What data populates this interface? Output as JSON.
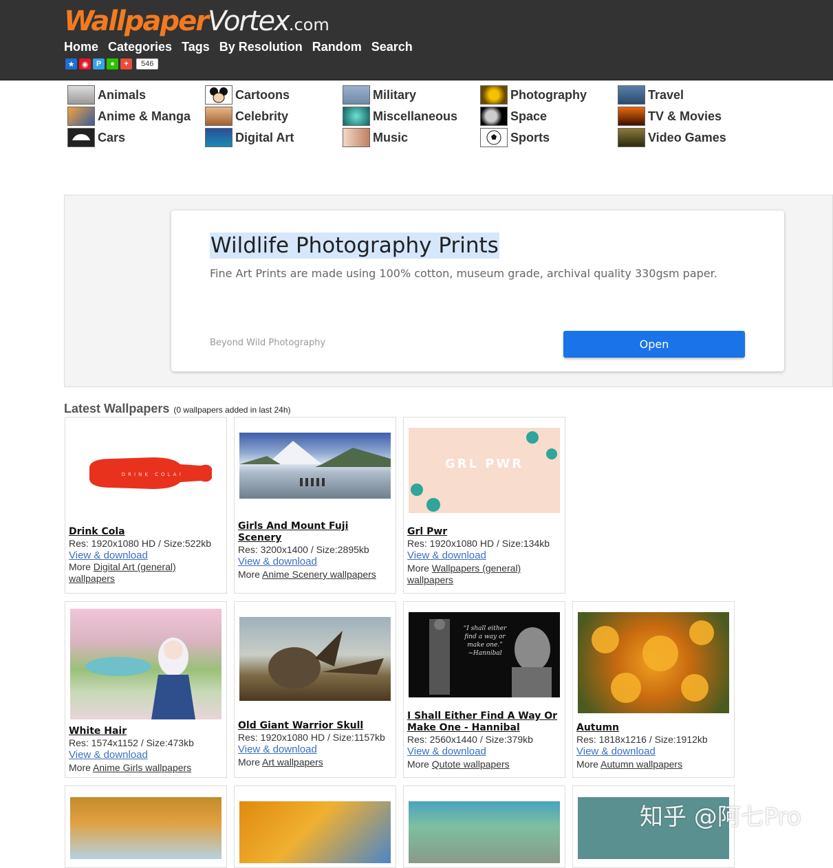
{
  "logo": {
    "part1": "Wallpaper",
    "part2": "Vortex",
    "part3": ".com"
  },
  "nav": [
    "Home",
    "Categories",
    "Tags",
    "By Resolution",
    "Random",
    "Search"
  ],
  "share": {
    "count": "546"
  },
  "categories": [
    {
      "label": "Animals"
    },
    {
      "label": "Cartoons"
    },
    {
      "label": "Military"
    },
    {
      "label": "Photography"
    },
    {
      "label": "Travel"
    },
    {
      "label": "Anime & Manga"
    },
    {
      "label": "Celebrity"
    },
    {
      "label": "Miscellaneous"
    },
    {
      "label": "Space"
    },
    {
      "label": "TV & Movies"
    },
    {
      "label": "Cars"
    },
    {
      "label": "Digital Art"
    },
    {
      "label": "Music"
    },
    {
      "label": "Sports"
    },
    {
      "label": "Video Games"
    }
  ],
  "ad": {
    "title": "Wildlife Photography Prints",
    "description": "Fine Art Prints are made using 100% cotton, museum grade, archival quality 330gsm paper.",
    "source": "Beyond Wild Photography",
    "button": "Open"
  },
  "latest": {
    "title": "Latest Wallpapers",
    "subtitle": "(0 wallpapers added in last 24h)"
  },
  "wallpapers": [
    {
      "name": "Drink Cola",
      "res": "Res: 1920x1080 HD / Size:522kb",
      "download": "View & download",
      "more_prefix": "More",
      "more_link": "Digital Art (general)",
      "more_suffix": "wallpapers"
    },
    {
      "name": "Girls And Mount Fuji Scenery",
      "res": "Res: 3200x1400 / Size:2895kb",
      "download": "View & download",
      "more_prefix": "More",
      "more_link": "Anime Scenery wallpapers",
      "more_suffix": ""
    },
    {
      "name": "Grl Pwr",
      "res": "Res: 1920x1080 HD / Size:134kb",
      "download": "View & download",
      "more_prefix": "More",
      "more_link": "Wallpapers (general)",
      "more_suffix": "wallpapers",
      "image_text": "GRL PWR"
    },
    {
      "name": "White Hair",
      "res": "Res: 1574x1152 / Size:473kb",
      "download": "View & download",
      "more_prefix": "More",
      "more_link": "Anime Girls wallpapers",
      "more_suffix": ""
    },
    {
      "name": "Old Giant Warrior Skull",
      "res": "Res: 1920x1080 HD / Size:1157kb",
      "download": "View & download",
      "more_prefix": "More",
      "more_link": "Art wallpapers",
      "more_suffix": ""
    },
    {
      "name": "I Shall Either Find A Way Or Make One - Hannibal",
      "res": "Res: 2560x1440 / Size:379kb",
      "download": "View & download",
      "more_prefix": "More",
      "more_link": "Qutote wallpapers",
      "more_suffix": "",
      "image_text": "“I shall either find a way or make one.” ~Hannibal"
    },
    {
      "name": "Autumn",
      "res": "Res: 1818x1216 / Size:1912kb",
      "download": "View & download",
      "more_prefix": "More",
      "more_link": "Autumn wallpapers",
      "more_suffix": ""
    }
  ],
  "drink_cola_label": "DRINK COLA!",
  "watermark": "知乎 @阿七Pro",
  "colors": {
    "header_bg": "#333333",
    "logo_orange": "#f47a20",
    "link_blue": "#3a6fc2",
    "ad_button": "#1a73e8"
  }
}
